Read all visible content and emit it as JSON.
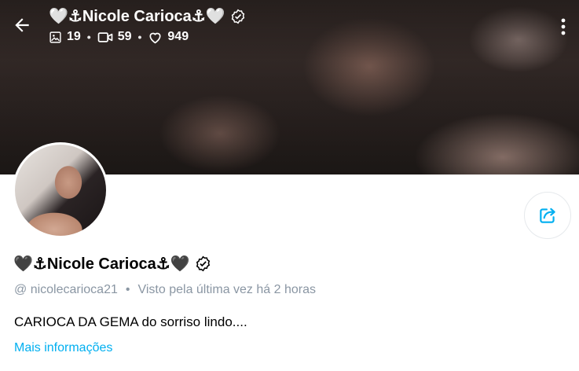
{
  "header": {
    "title": "🤍⚓︎Nicole Carioca⚓︎🤍",
    "stats": {
      "photos": "19",
      "videos": "59",
      "likes": "949"
    }
  },
  "profile": {
    "name": "🖤⚓︎Nicole Carioca⚓︎🖤",
    "username": "@ nicolecarioca21",
    "separator": "•",
    "last_seen": "Visto pela última vez há 2 horas",
    "bio": "CARIOCA DA GEMA do sorriso lindo....",
    "more_info_label": "Mais informações"
  },
  "icons": {
    "back": "arrow-left-icon",
    "photos": "image-icon",
    "videos": "video-icon",
    "likes": "heart-icon",
    "more": "more-vertical-icon",
    "share": "share-icon",
    "verified": "verified-badge-icon"
  },
  "colors": {
    "accent": "#00aff0",
    "muted": "#8a96a3",
    "text": "#000000"
  }
}
